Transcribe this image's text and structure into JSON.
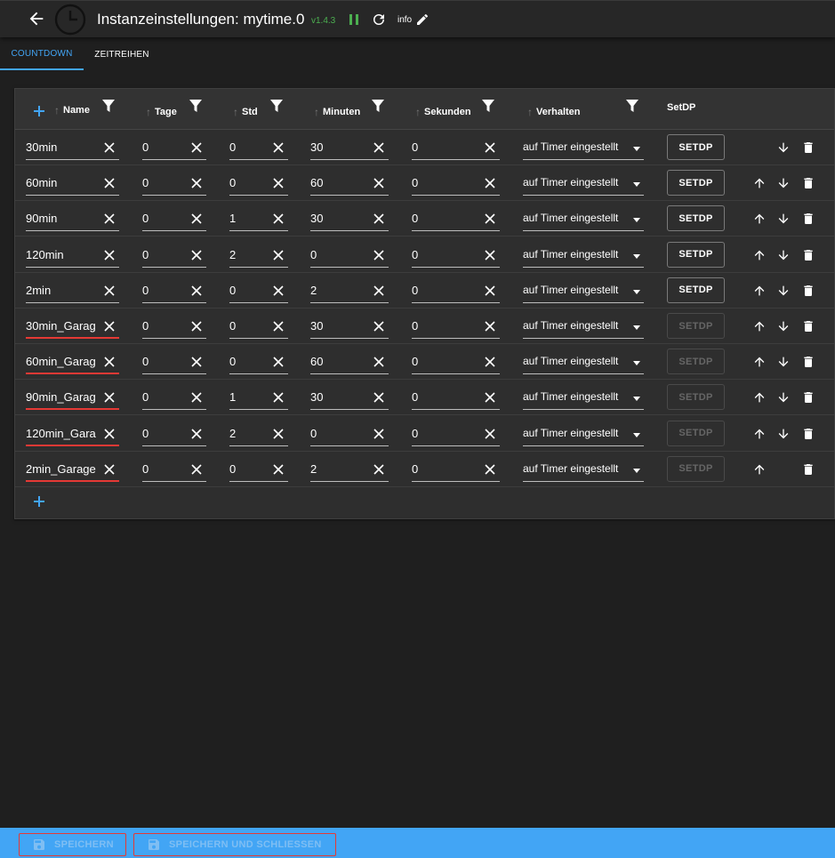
{
  "header": {
    "title": "Instanzeinstellungen: mytime.0",
    "version": "v1.4.3",
    "info_label": "info",
    "version_color": "#4caf50"
  },
  "tabs": [
    {
      "label": "COUNTDOWN",
      "active": true
    },
    {
      "label": "ZEITREIHEN",
      "active": false
    }
  ],
  "table": {
    "columns": {
      "name": "Name",
      "tage": "Tage",
      "std": "Std",
      "minuten": "Minuten",
      "sekunden": "Sekunden",
      "verhalten": "Verhalten",
      "setdp": "SetDP"
    },
    "button_label": "SETDP",
    "rows": [
      {
        "name": "30min",
        "tage": "0",
        "std": "0",
        "minuten": "30",
        "sekunden": "0",
        "verhalten": "auf Timer eingestellt",
        "name_error": false,
        "setdp_enabled": true,
        "up": false,
        "down": true
      },
      {
        "name": "60min",
        "tage": "0",
        "std": "0",
        "minuten": "60",
        "sekunden": "0",
        "verhalten": "auf Timer eingestellt",
        "name_error": false,
        "setdp_enabled": true,
        "up": true,
        "down": true
      },
      {
        "name": "90min",
        "tage": "0",
        "std": "1",
        "minuten": "30",
        "sekunden": "0",
        "verhalten": "auf Timer eingestellt",
        "name_error": false,
        "setdp_enabled": true,
        "up": true,
        "down": true
      },
      {
        "name": "120min",
        "tage": "0",
        "std": "2",
        "minuten": "0",
        "sekunden": "0",
        "verhalten": "auf Timer eingestellt",
        "name_error": false,
        "setdp_enabled": true,
        "up": true,
        "down": true
      },
      {
        "name": "2min",
        "tage": "0",
        "std": "0",
        "minuten": "2",
        "sekunden": "0",
        "verhalten": "auf Timer eingestellt",
        "name_error": false,
        "setdp_enabled": true,
        "up": true,
        "down": true
      },
      {
        "name": "30min_Garag",
        "tage": "0",
        "std": "0",
        "minuten": "30",
        "sekunden": "0",
        "verhalten": "auf Timer eingestellt",
        "name_error": true,
        "setdp_enabled": false,
        "up": true,
        "down": true
      },
      {
        "name": "60min_Garag",
        "tage": "0",
        "std": "0",
        "minuten": "60",
        "sekunden": "0",
        "verhalten": "auf Timer eingestellt",
        "name_error": true,
        "setdp_enabled": false,
        "up": true,
        "down": true
      },
      {
        "name": "90min_Garag",
        "tage": "0",
        "std": "1",
        "minuten": "30",
        "sekunden": "0",
        "verhalten": "auf Timer eingestellt",
        "name_error": true,
        "setdp_enabled": false,
        "up": true,
        "down": true
      },
      {
        "name": "120min_Gara",
        "tage": "0",
        "std": "2",
        "minuten": "0",
        "sekunden": "0",
        "verhalten": "auf Timer eingestellt",
        "name_error": true,
        "setdp_enabled": false,
        "up": true,
        "down": true
      },
      {
        "name": "2min_Garage",
        "tage": "0",
        "std": "0",
        "minuten": "2",
        "sekunden": "0",
        "verhalten": "auf Timer eingestellt",
        "name_error": true,
        "setdp_enabled": false,
        "up": true,
        "down": false
      }
    ]
  },
  "footer": {
    "save_label": "SPEICHERN",
    "save_close_label": "SPEICHERN UND SCHLIESSEN"
  },
  "colors": {
    "accent": "#42a5f5",
    "error": "#e53935"
  }
}
